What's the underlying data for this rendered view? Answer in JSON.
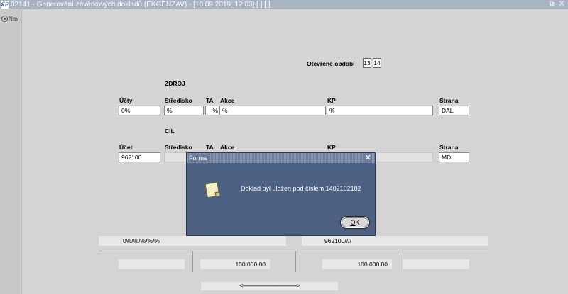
{
  "window": {
    "title": "02141 - Generování závěrkových dokladů (EKGENZAV) - [10.09.2019; 12:03]  [ ]  [ ]",
    "app_icon_text": "ЯF",
    "controls": "⧉ ✕"
  },
  "nav": {
    "label": "Nav"
  },
  "period": {
    "label": "Otevřené období",
    "values": [
      "13",
      "14"
    ]
  },
  "zdroj": {
    "heading": "ZDROJ",
    "labels": {
      "ucty": "Účty",
      "stredisko": "Středisko",
      "ta": "TA",
      "akce": "Akce",
      "kp": "KP",
      "strana": "Strana"
    },
    "values": {
      "ucty": "0%",
      "stredisko": "%",
      "ta": "%",
      "akce": "%",
      "kp": "%",
      "strana": "DAL"
    }
  },
  "cil": {
    "heading": "CÍL",
    "labels": {
      "ucet": "Účet",
      "stredisko": "Středisko",
      "ta": "TA",
      "akce": "Akce",
      "kp": "KP",
      "strana": "Strana"
    },
    "values": {
      "ucet": "962100",
      "strana": "MD"
    }
  },
  "summary": {
    "source_mask": "0%/%/%/%/%",
    "target_mask": "962100////",
    "amount_left": "100 000.00",
    "amount_right": "100 000.00"
  },
  "scrollbar": {
    "text": "<---------------------------------------------->"
  },
  "dialog": {
    "title": "Forms",
    "close": "✕",
    "message": "Doklad byl uložen pod číslem 1402102182",
    "ok_label": "OK",
    "ok_mnemonic_rest": "K",
    "ok_mnemonic": "O"
  }
}
